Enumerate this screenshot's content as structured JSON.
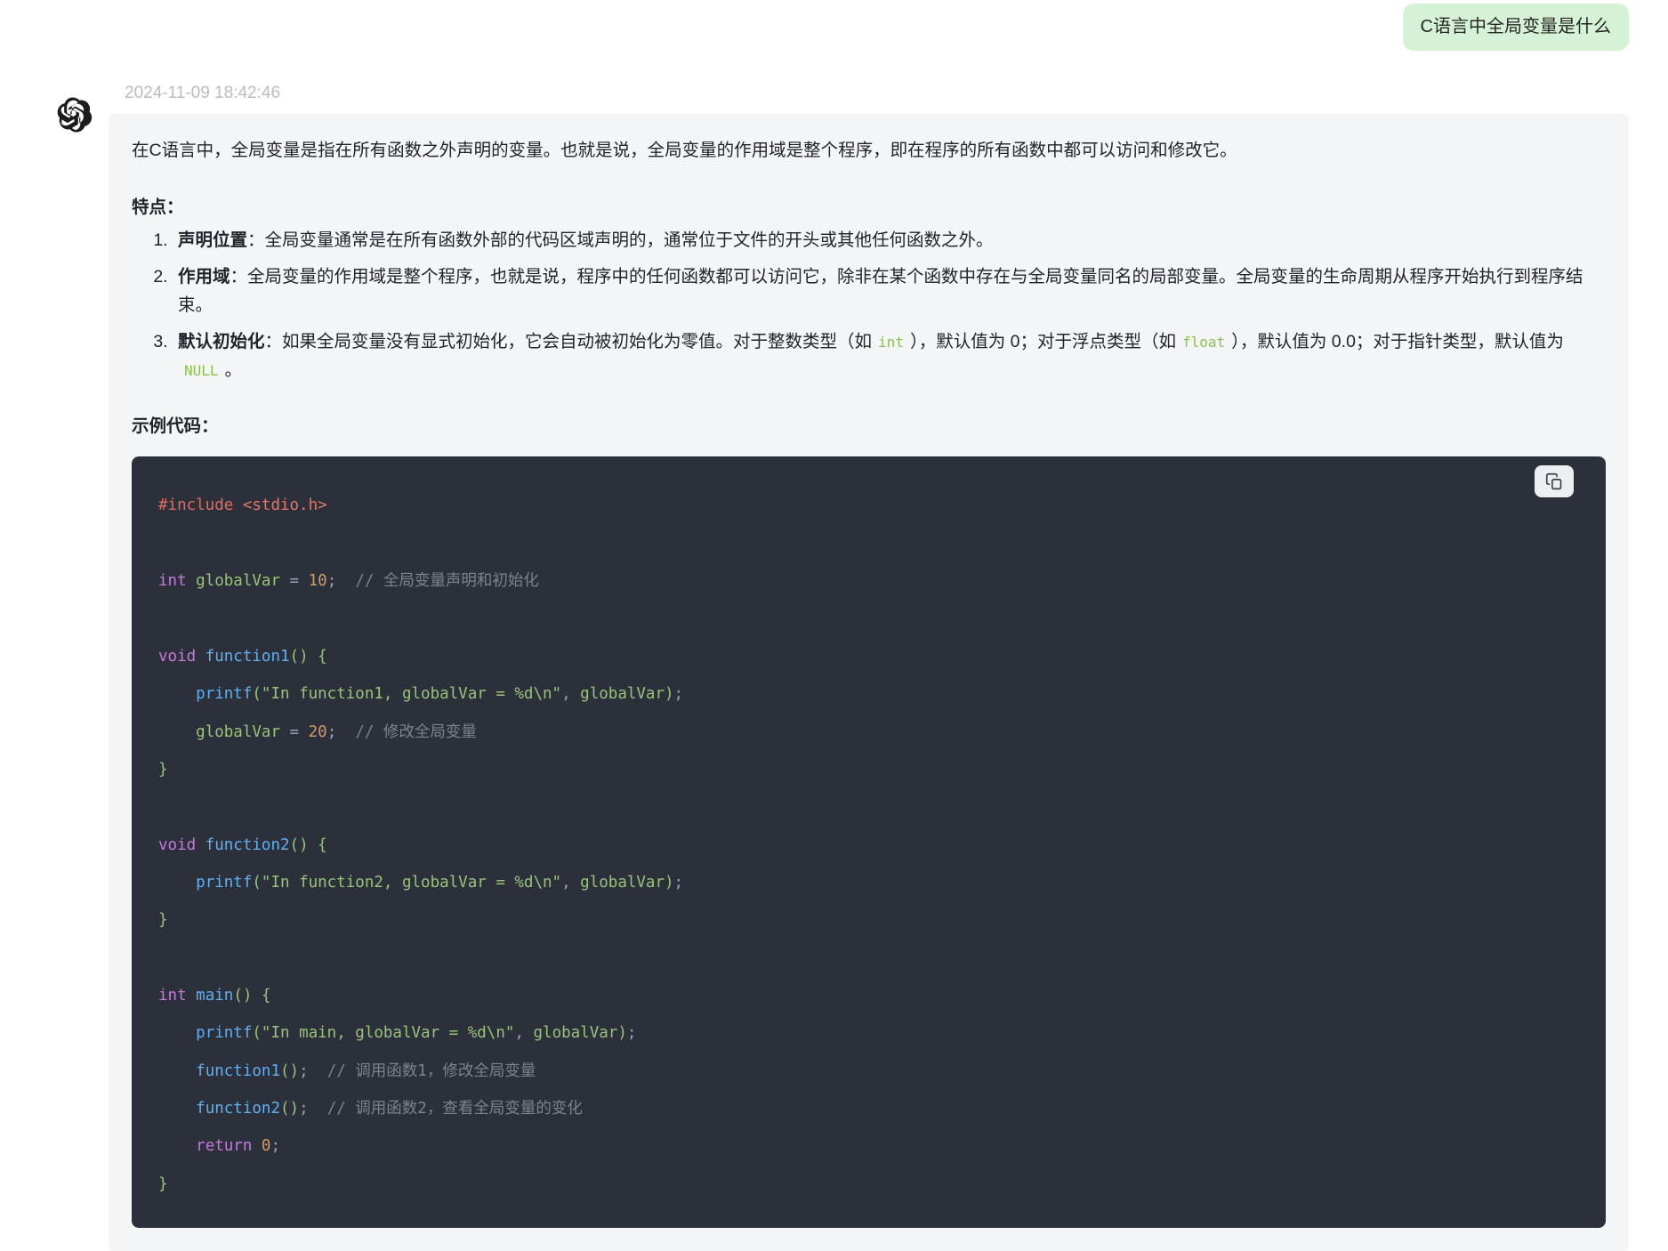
{
  "conversation": {
    "user_message": "C语言中全局变量是什么",
    "assistant": {
      "timestamp": "2024-11-09 18:42:46",
      "avatar_icon": "openai-logo-icon",
      "intro_paragraph": "在C语言中，全局变量是指在所有函数之外声明的变量。也就是说，全局变量的作用域是整个程序，即在程序的所有函数中都可以访问和修改它。",
      "features_heading": "特点：",
      "features": [
        {
          "title": "声明位置",
          "separator": "：",
          "body": "全局变量通常是在所有函数外部的代码区域声明的，通常位于文件的开头或其他任何函数之外。"
        },
        {
          "title": "作用域",
          "separator": "：",
          "body": "全局变量的作用域是整个程序，也就是说，程序中的任何函数都可以访问它，除非在某个函数中存在与全局变量同名的局部变量。全局变量的生命周期从程序开始执行到程序结束。"
        },
        {
          "title": "默认初始化",
          "separator": "：",
          "body_part1": "如果全局变量没有显式初始化，它会自动被初始化为零值。对于整数类型（如",
          "code1": "int",
          "body_part2": "），默认值为 0；对于浮点类型（如",
          "code2": "float",
          "body_part3": "），默认值为 0.0；对于指针类型，默认值为",
          "code3": "NULL",
          "body_part4": "。"
        }
      ],
      "example_heading": "示例代码：",
      "code_block": {
        "language": "c",
        "copy_button_label": "copy-icon",
        "lines": [
          "#include <stdio.h>",
          "",
          "int globalVar = 10;  // 全局变量声明和初始化",
          "",
          "void function1() {",
          "    printf(\"In function1, globalVar = %d\\n\", globalVar);",
          "    globalVar = 20;  // 修改全局变量",
          "}",
          "",
          "void function2() {",
          "    printf(\"In function2, globalVar = %d\\n\", globalVar);",
          "}",
          "",
          "int main() {",
          "    printf(\"In main, globalVar = %d\\n\", globalVar);",
          "    function1();  // 调用函数1，修改全局变量",
          "    function2();  // 调用函数2，查看全局变量的变化",
          "    return 0;",
          "}"
        ]
      }
    }
  },
  "colors": {
    "user_bubble_bg": "#d6f2d6",
    "assistant_bubble_bg": "#f4f5f7",
    "code_bg": "#2b303b",
    "timestamp": "#b9bcc2",
    "inline_code": "#8bc34a"
  }
}
